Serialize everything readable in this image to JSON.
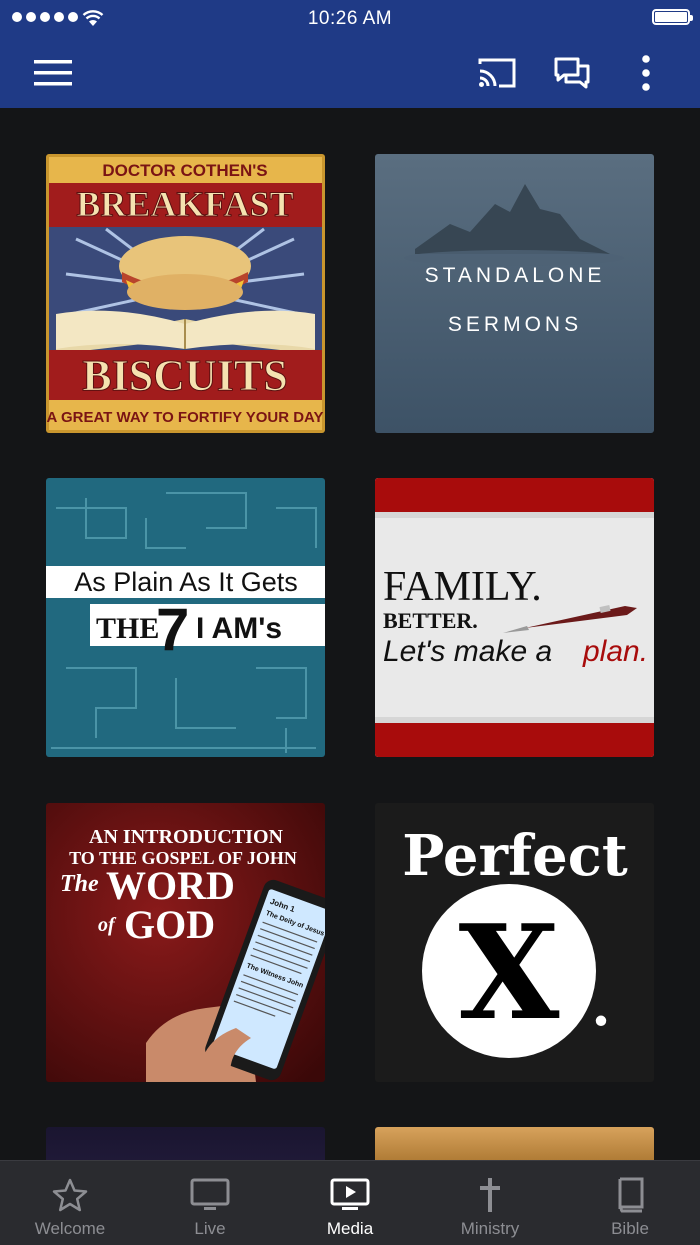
{
  "status_bar": {
    "time": "10:26 AM"
  },
  "top_bar": {
    "menu_icon": "hamburger-menu-icon",
    "cast_icon": "cast-icon",
    "chat_icon": "chat-icon",
    "more_icon": "more-vertical-icon"
  },
  "media_items": [
    {
      "title_lines": [
        "DOCTOR COTHEN'S",
        "BREAKFAST",
        "BISCUITS",
        "A GREAT WAY TO FORTIFY YOUR DAY"
      ]
    },
    {
      "title_lines": [
        "STANDALONE",
        "SERMONS"
      ]
    },
    {
      "title_lines": [
        "As Plain As It Gets",
        "THE",
        "7",
        "I AM's"
      ]
    },
    {
      "title_lines": [
        "FAMILY.",
        "BETTER.",
        "Let's make a",
        "plan."
      ]
    },
    {
      "title_lines": [
        "AN INTRODUCTION",
        "TO THE GOSPEL OF JOHN",
        "The",
        "WORD",
        "of",
        "GOD"
      ],
      "phone_text": [
        "John 1",
        "The Deity of Jesus",
        "The Witness John"
      ]
    },
    {
      "title_lines": [
        "Perfect",
        "X",
        "."
      ]
    }
  ],
  "tab_bar": [
    {
      "label": "Welcome",
      "icon": "star-icon",
      "active": false
    },
    {
      "label": "Live",
      "icon": "tv-icon",
      "active": false
    },
    {
      "label": "Media",
      "icon": "media-play-icon",
      "active": true
    },
    {
      "label": "Ministry",
      "icon": "cross-icon",
      "active": false
    },
    {
      "label": "Bible",
      "icon": "book-icon",
      "active": false
    }
  ],
  "colors": {
    "brand_bar": "#1f3a86",
    "background": "#141517",
    "tab_bar": "#2a2b2f",
    "tab_active": "#ffffff",
    "tab_inactive": "#8d8e93"
  }
}
